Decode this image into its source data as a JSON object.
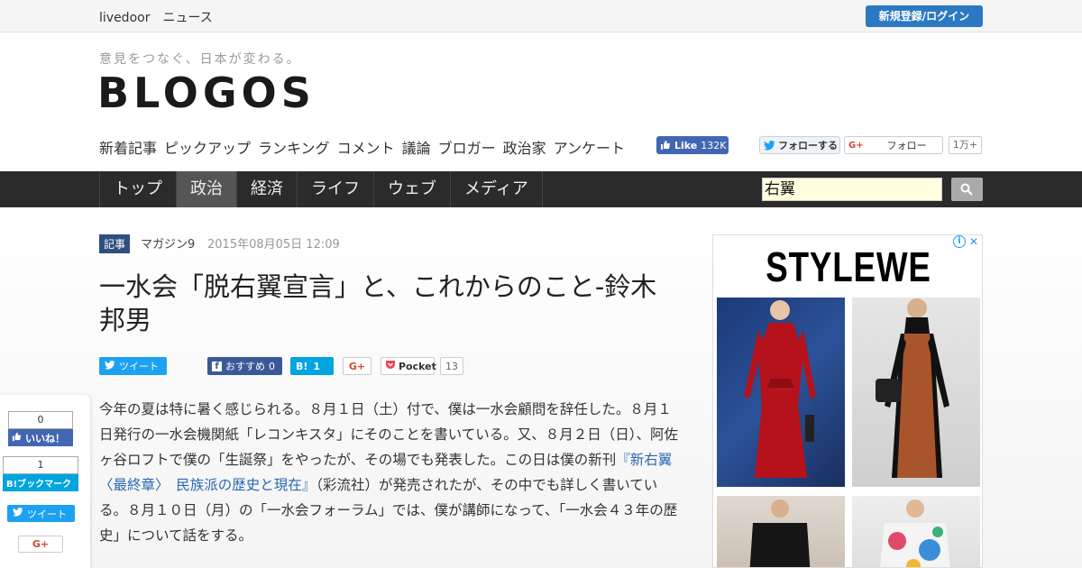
{
  "topbar": {
    "site_name": "livedoor　ニュース",
    "login_label": "新規登録/ログイン"
  },
  "header": {
    "tagline": "意見をつなぐ、日本が変わる。",
    "logo": "BLOGOS",
    "subnav": [
      "新着記事",
      "ピックアップ",
      "ランキング",
      "コメント",
      "議論",
      "ブロガー",
      "政治家",
      "アンケート"
    ],
    "fb_like_label": "Like",
    "fb_like_count": "132K",
    "twitter_follow_label": "フォローする",
    "gplus_follow_label": "フォロー",
    "gplus_count": "1万+"
  },
  "mainnav": {
    "items": [
      "トップ",
      "政治",
      "経済",
      "ライフ",
      "ウェブ",
      "メディア"
    ],
    "active": "政治",
    "search_value": "右翼"
  },
  "article": {
    "category": "記事",
    "source": "マガジン9",
    "date": "2015年08月05日 12:09",
    "title": "一水会「脱右翼宣言」と、これからのこと-鈴木邦男",
    "share": {
      "tweet": "ツイート",
      "fb_recommend": "おすすめ",
      "fb_count": "0",
      "hatena_count": "1",
      "pocket": "Pocket",
      "pocket_count": "13"
    },
    "body_before_link": "今年の夏は特に暑く感じられる。８月１日（土）付で、僕は一水会顧問を辞任した。８月１日発行の一水会機関紙「レコンキスタ」にそのことを書いている。又、８月２日（日）、阿佐ヶ谷ロフトで僕の「生誕祭」をやったが、その場でも発表した。この日は僕の新刊",
    "body_link": "『新右翼〈最終章〉　民族派の歴史と現在』",
    "body_after_link": "（彩流社）が発売されたが、その中でも詳しく書いている。８月１０日（月）の「一水会フォーラム」では、僕が講師になって、「一水会４３年の歴史」について話をする。"
  },
  "floating_share": {
    "fb_count": "0",
    "fb_label": "いいね！",
    "hatena_count": "1",
    "hatena_label": "B!ブックマーク",
    "tweet": "ツイート"
  },
  "ad": {
    "brand": "STYLEWE"
  }
}
